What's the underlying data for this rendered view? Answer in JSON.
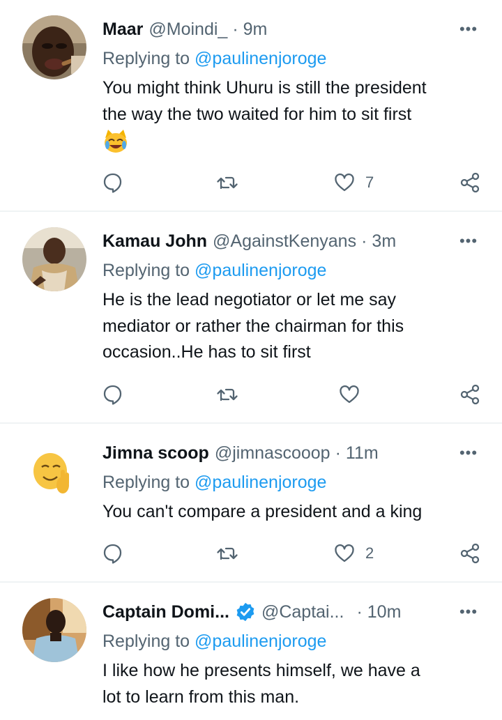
{
  "replies": [
    {
      "name": "Maar",
      "handle": "@Moindi_",
      "time": "9m",
      "replying_prefix": "Replying to",
      "replying_to": "@paulinenjoroge",
      "text_lines": [
        "You might think Uhuru is still the president",
        "the way the two waited for him to sit first"
      ],
      "emoji": "joy-cat",
      "likes": "7",
      "verified": false
    },
    {
      "name": "Kamau John",
      "handle": "@AgainstKenyans",
      "time": "3m",
      "replying_prefix": "Replying to",
      "replying_to": "@paulinenjoroge",
      "text_lines": [
        "He is the lead negotiator or let me say",
        "mediator or rather the chairman for this",
        "occasion..He has to sit first"
      ],
      "likes": "",
      "verified": false
    },
    {
      "name": "Jimna scoop",
      "handle": "@jimnascooop",
      "time": "11m",
      "replying_prefix": "Replying to",
      "replying_to": "@paulinenjoroge",
      "text_lines": [
        "You can't compare a president and a king"
      ],
      "likes": "2",
      "verified": false
    },
    {
      "name": "Captain Domi...",
      "handle": "@Captai...",
      "time": "10m",
      "replying_prefix": "Replying to",
      "replying_to": "@paulinenjoroge",
      "text_lines": [
        "I like how he presents himself, we have a",
        "lot to learn from this man."
      ],
      "verified": true
    }
  ],
  "separator": "·",
  "more_glyph": "•••",
  "colors": {
    "link": "#1d9bf0",
    "secondary": "#536471",
    "text": "#0f1419",
    "divider": "#eff3f4",
    "verified": "#1d9bf0"
  },
  "icons": [
    "reply-icon",
    "retweet-icon",
    "like-icon",
    "share-icon",
    "more-icon",
    "verified-icon"
  ]
}
